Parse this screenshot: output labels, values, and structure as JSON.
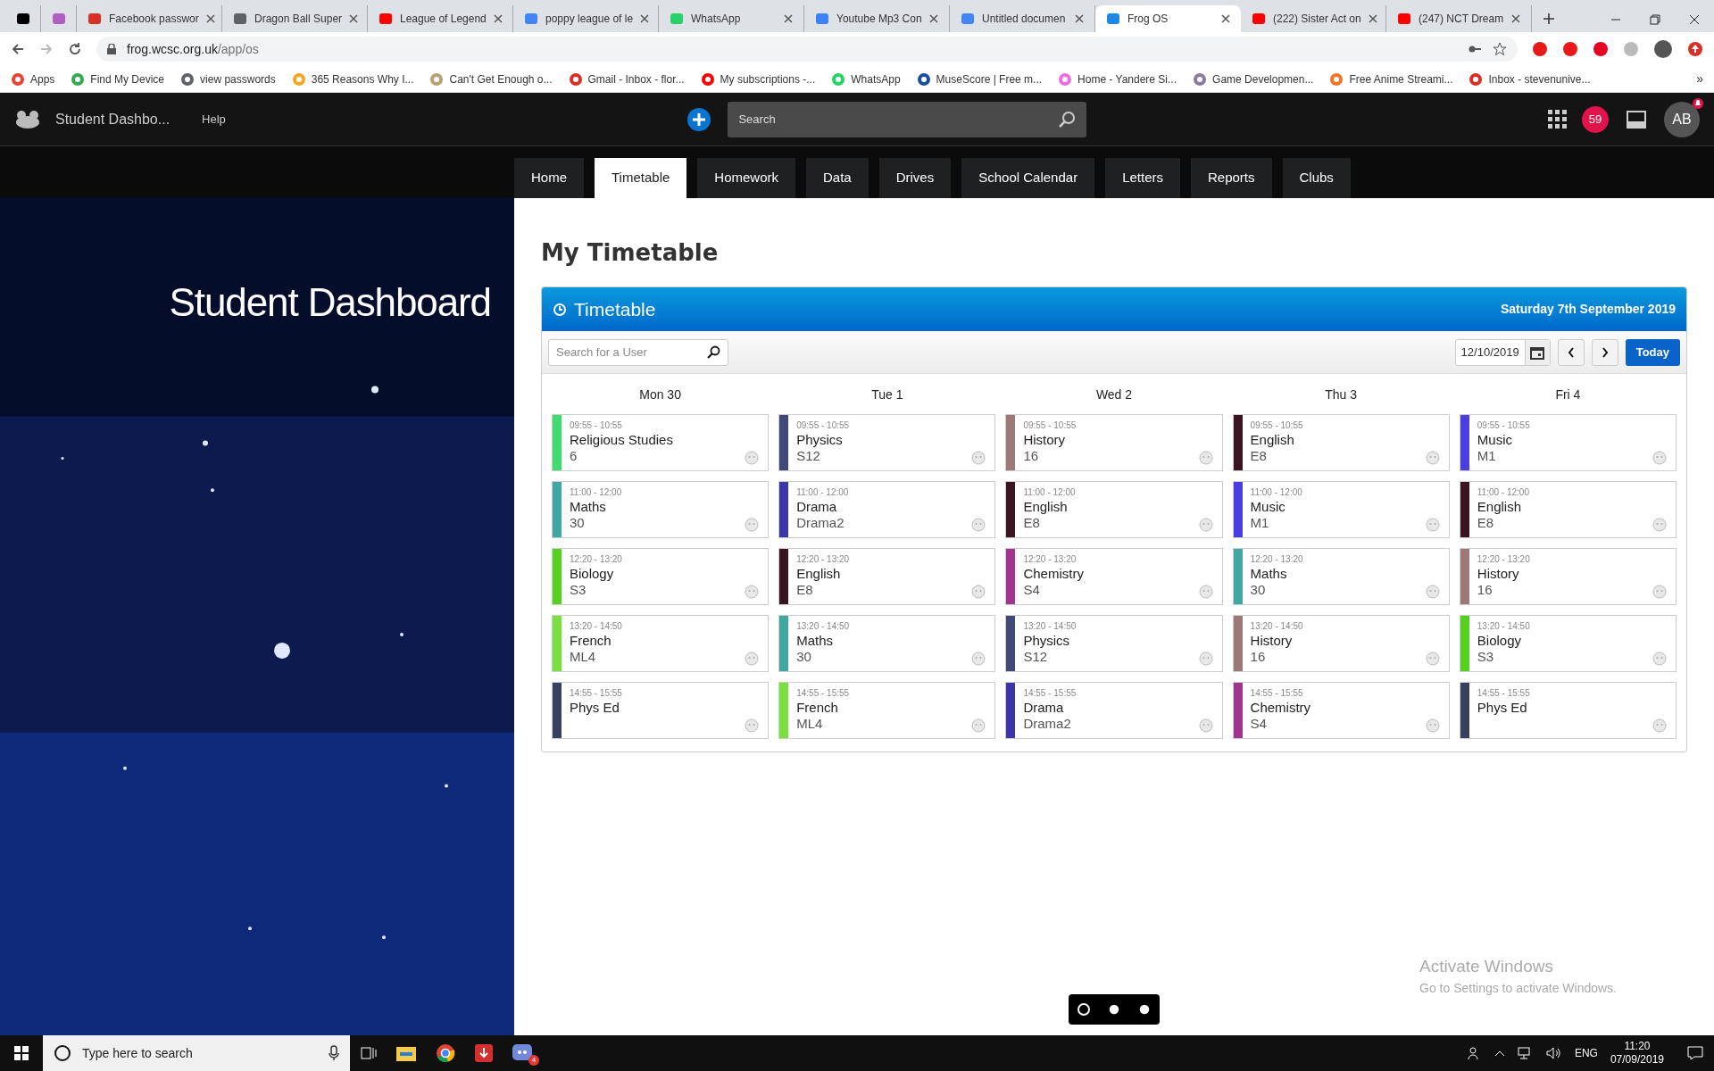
{
  "browser": {
    "tabs": [
      {
        "kind": "pinned",
        "selected": false,
        "color": "#000000"
      },
      {
        "kind": "pinned",
        "selected": false,
        "color": "#b060c0"
      },
      {
        "kind": "normal",
        "title": "Facebook passwor",
        "selected": false,
        "color": "#d93025"
      },
      {
        "kind": "normal",
        "title": "Dragon Ball Super",
        "selected": false,
        "color": "#5f6368"
      },
      {
        "kind": "normal",
        "title": "League of Legend",
        "selected": false,
        "color": "#ff0000"
      },
      {
        "kind": "normal",
        "title": "poppy league of le",
        "selected": false,
        "color": "#4285f4"
      },
      {
        "kind": "normal",
        "title": "WhatsApp",
        "selected": false,
        "color": "#25d366"
      },
      {
        "kind": "normal",
        "title": "Youtube Mp3 Con",
        "selected": false,
        "color": "#3b82f6"
      },
      {
        "kind": "normal",
        "title": "Untitled documen",
        "selected": false,
        "color": "#4285f4"
      },
      {
        "kind": "normal",
        "title": "Frog OS",
        "selected": true,
        "color": "#1e88e5"
      },
      {
        "kind": "normal",
        "title": "(222) Sister Act on",
        "selected": false,
        "color": "#ff0000"
      },
      {
        "kind": "normal",
        "title": "(247) NCT Dream",
        "selected": false,
        "color": "#ff0000"
      }
    ],
    "url_host": "frog.wcsc.org.uk",
    "url_path": "/app/os",
    "bookmarks": [
      {
        "label": "Apps",
        "color": "#ea4335"
      },
      {
        "label": "Find My Device",
        "color": "#34a853"
      },
      {
        "label": "view passwords",
        "color": "#5f6368"
      },
      {
        "label": "365 Reasons Why I...",
        "color": "#f5a623"
      },
      {
        "label": "Can't Get Enough o...",
        "color": "#b8a070"
      },
      {
        "label": "Gmail - Inbox - flor...",
        "color": "#d93025"
      },
      {
        "label": "My subscriptions -...",
        "color": "#ff0000"
      },
      {
        "label": "WhatsApp",
        "color": "#25d366"
      },
      {
        "label": "MuseScore | Free m...",
        "color": "#1a4fa0"
      },
      {
        "label": "Home - Yandere Si...",
        "color": "#f06ce0"
      },
      {
        "label": "Game Developmen...",
        "color": "#8a7aa0"
      },
      {
        "label": "Free Anime Streami...",
        "color": "#f47521"
      },
      {
        "label": "Inbox - stevenunive...",
        "color": "#d93025"
      }
    ],
    "more": "»"
  },
  "app_bar": {
    "title": "Student Dashbo...",
    "help": "Help",
    "search": {
      "placeholder": "Search"
    },
    "notifications": "59",
    "avatar": "AB"
  },
  "nav_tabs": [
    {
      "label": "Home",
      "selected": false
    },
    {
      "label": "Timetable",
      "selected": true
    },
    {
      "label": "Homework",
      "selected": false
    },
    {
      "label": "Data",
      "selected": false
    },
    {
      "label": "Drives",
      "selected": false
    },
    {
      "label": "School Calendar",
      "selected": false
    },
    {
      "label": "Letters",
      "selected": false
    },
    {
      "label": "Reports",
      "selected": false
    },
    {
      "label": "Clubs",
      "selected": false
    }
  ],
  "sidebar": {
    "heading": "Student Dashboard"
  },
  "page_title": "My Timetable",
  "timetable": {
    "title": "Timetable",
    "date": "Saturday 7th September 2019",
    "user_search": {
      "placeholder": "Search for a User"
    },
    "date_field": "12/10/2019",
    "today_button": "Today",
    "days": [
      {
        "name": "Mon 30",
        "lessons": [
          {
            "time": "09:55 - 10:55",
            "subject": "Religious Studies",
            "room": "6",
            "color": "#3ddc6e"
          },
          {
            "time": "11:00 - 12:00",
            "subject": "Maths",
            "room": "30",
            "color": "#40a8a0"
          },
          {
            "time": "12:20 - 13:20",
            "subject": "Biology",
            "room": "S3",
            "color": "#55d020"
          },
          {
            "time": "13:20 - 14:50",
            "subject": "French",
            "room": "ML4",
            "color": "#7ae040"
          },
          {
            "time": "14:55 - 15:55",
            "subject": "Phys Ed",
            "color": "#3a4060"
          }
        ]
      },
      {
        "name": "Tue 1",
        "lessons": [
          {
            "time": "09:55 - 10:55",
            "subject": "Physics",
            "room": "S12",
            "color": "#3f4a7a"
          },
          {
            "time": "11:00 - 12:00",
            "subject": "Drama",
            "room": "Drama2",
            "color": "#3a35a8"
          },
          {
            "time": "12:20 - 13:20",
            "subject": "English",
            "room": "E8",
            "color": "#3a1420"
          },
          {
            "time": "13:20 - 14:50",
            "subject": "Maths",
            "room": "30",
            "color": "#40a8a0"
          },
          {
            "time": "14:55 - 15:55",
            "subject": "French",
            "room": "ML4",
            "color": "#7ae040"
          }
        ]
      },
      {
        "name": "Wed 2",
        "lessons": [
          {
            "time": "09:55 - 10:55",
            "subject": "History",
            "room": "16",
            "color": "#9c7878"
          },
          {
            "time": "11:00 - 12:00",
            "subject": "English",
            "room": "E8",
            "color": "#3a1420"
          },
          {
            "time": "12:20 - 13:20",
            "subject": "Chemistry",
            "room": "S4",
            "color": "#a03590"
          },
          {
            "time": "13:20 - 14:50",
            "subject": "Physics",
            "room": "S12",
            "color": "#3f4a7a"
          },
          {
            "time": "14:55 - 15:55",
            "subject": "Drama",
            "room": "Drama2",
            "color": "#3a35a8"
          }
        ]
      },
      {
        "name": "Thu 3",
        "lessons": [
          {
            "time": "09:55 - 10:55",
            "subject": "English",
            "room": "E8",
            "color": "#3a1420"
          },
          {
            "time": "11:00 - 12:00",
            "subject": "Music",
            "room": "M1",
            "color": "#4a3ee0"
          },
          {
            "time": "12:20 - 13:20",
            "subject": "Maths",
            "room": "30",
            "color": "#40a8a0"
          },
          {
            "time": "13:20 - 14:50",
            "subject": "History",
            "room": "16",
            "color": "#9c7878"
          },
          {
            "time": "14:55 - 15:55",
            "subject": "Chemistry",
            "room": "S4",
            "color": "#a03590"
          }
        ]
      },
      {
        "name": "Fri 4",
        "lessons": [
          {
            "time": "09:55 - 10:55",
            "subject": "Music",
            "room": "M1",
            "color": "#4a3ee0"
          },
          {
            "time": "11:00 - 12:00",
            "subject": "English",
            "room": "E8",
            "color": "#3a1420"
          },
          {
            "time": "12:20 - 13:20",
            "subject": "History",
            "room": "16",
            "color": "#9c7878"
          },
          {
            "time": "13:20 - 14:50",
            "subject": "Biology",
            "room": "S3",
            "color": "#55d020"
          },
          {
            "time": "14:55 - 15:55",
            "subject": "Phys Ed",
            "color": "#3a4060"
          }
        ]
      }
    ]
  },
  "pager": [
    {
      "selected": true
    },
    {
      "selected": false
    },
    {
      "selected": false
    }
  ],
  "activation": {
    "title": "Activate Windows",
    "subtitle": "Go to Settings to activate Windows."
  },
  "taskbar": {
    "search": {
      "placeholder": "Type here to search"
    },
    "badge": "4",
    "language": "ENG",
    "time": "11:20",
    "date": "07/09/2019"
  }
}
